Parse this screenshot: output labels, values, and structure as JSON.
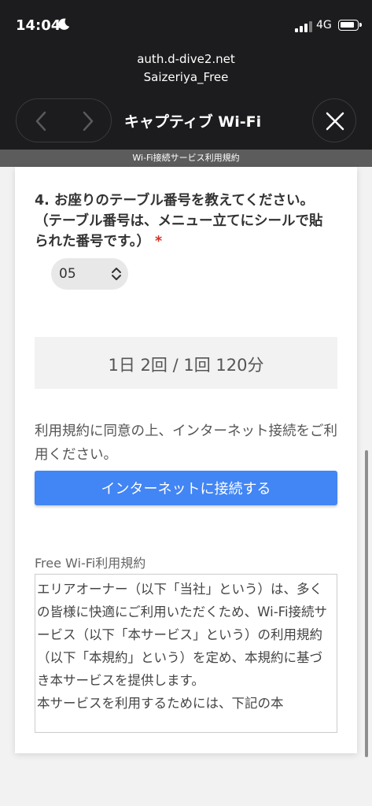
{
  "status_bar": {
    "time": "14:04",
    "network": "4G"
  },
  "url_bar": {
    "domain": "auth.d-dive2.net",
    "ssid": "Saizeriya_Free"
  },
  "nav": {
    "title": "キャプティブ Wi-Fi"
  },
  "subbar": {
    "text": "Wi-Fi接続サービス利用規約"
  },
  "form": {
    "question": "4. お座りのテーブル番号を教えてください。（テーブル番号は、メニュー立てにシールで貼られた番号です。）",
    "required_mark": "*",
    "table_number": "05",
    "limits": "1日 2回 / 1回 120分",
    "consent": "利用規約に同意の上、インターネット接続をご利用ください。",
    "connect_label": "インターネットに接続する"
  },
  "terms": {
    "title": "Free Wi-Fi利用規約",
    "text": "エリアオーナー（以下「当社」という）は、多くの皆様に快適にご利用いただくため、Wi-Fi接続サービス（以下「本サービス」という）の利用規約（以下「本規約」という）を定め、本規約に基づき本サービスを提供します。\n本サービスを利用するためには、下記の本"
  },
  "icons": {
    "moon": "moon-icon",
    "back": "chevron-left-icon",
    "forward": "chevron-right-icon",
    "close": "close-icon",
    "select": "chevron-up-down-icon"
  },
  "colors": {
    "accent": "#4285f4",
    "required": "#d93025",
    "topbar": "#1c1c1e"
  }
}
